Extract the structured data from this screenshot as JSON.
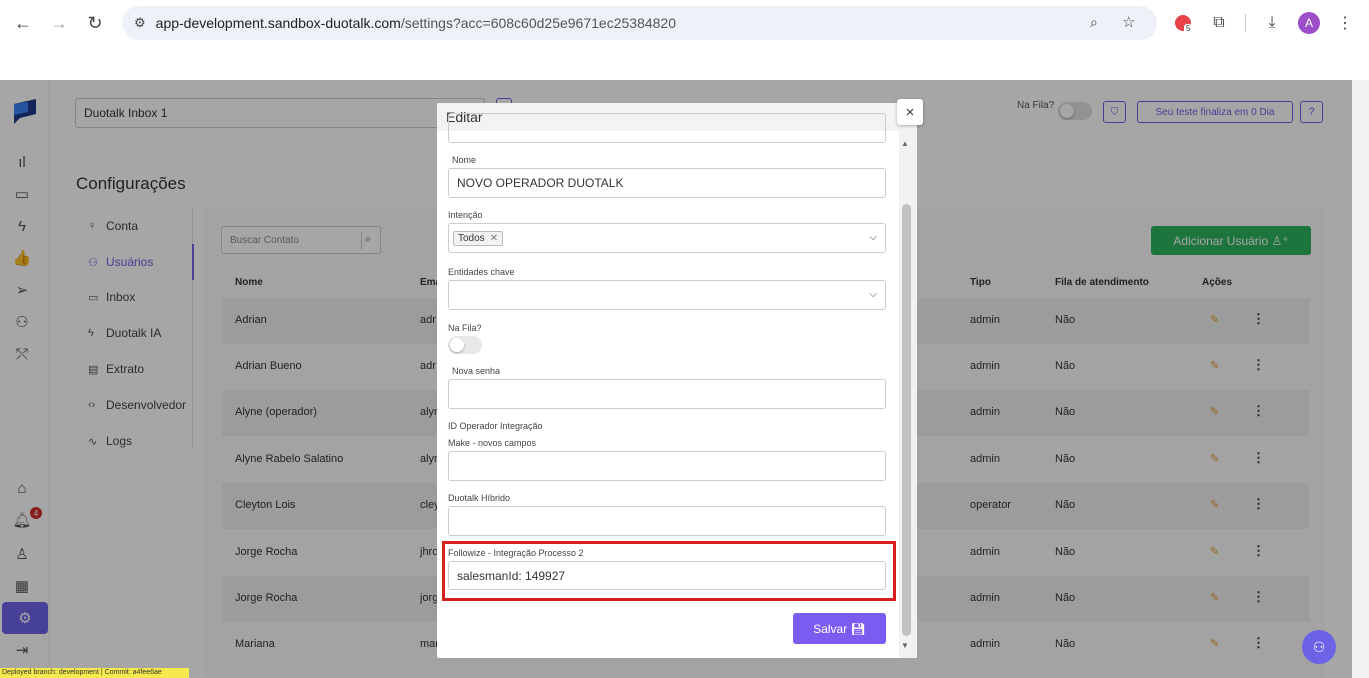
{
  "browser": {
    "url_host": "app-development.sandbox-duotalk.com",
    "url_path": "/settings?acc=608c60d25e9671ec25384820",
    "profile_initial": "A",
    "ext_badge": "5"
  },
  "header": {
    "inbox_select": "Duotalk Inbox 1",
    "queue_label": "Na Fila?",
    "trial_label": "Seu teste finaliza em 0 Dia",
    "help_label": "?"
  },
  "rail": {
    "notification_count": "4"
  },
  "page": {
    "title": "Configurações"
  },
  "settings_menu": [
    {
      "label": "Conta",
      "icon": "medal-icon"
    },
    {
      "label": "Usuários",
      "icon": "users-icon"
    },
    {
      "label": "Inbox",
      "icon": "inbox-icon"
    },
    {
      "label": "Duotalk IA",
      "icon": "bolt-icon"
    },
    {
      "label": "Extrato",
      "icon": "document-icon"
    },
    {
      "label": "Desenvolvedor",
      "icon": "code-icon"
    },
    {
      "label": "Logs",
      "icon": "activity-icon"
    }
  ],
  "users": {
    "search_placeholder": "Buscar Contato",
    "add_button": "Adicionar Usuário",
    "columns": [
      "Nome",
      "Email",
      "Tipo",
      "Fila de atendimento",
      "Ações"
    ],
    "rows": [
      {
        "name": "Adrian",
        "email": "adr",
        "type": "admin",
        "queue": "Não"
      },
      {
        "name": "Adrian Bueno",
        "email": "adr",
        "type": "admin",
        "queue": "Não"
      },
      {
        "name": "Alyne (operador)",
        "email": "alyr",
        "type": "admin",
        "queue": "Não"
      },
      {
        "name": "Alyne Rabelo Salatino",
        "email": "alyr",
        "type": "admin",
        "queue": "Não"
      },
      {
        "name": "Cleyton Lois",
        "email": "cley",
        "type": "operator",
        "queue": "Não"
      },
      {
        "name": "Jorge Rocha",
        "email": "jhro",
        "type": "admin",
        "queue": "Não"
      },
      {
        "name": "Jorge Rocha",
        "email": "jorg",
        "type": "admin",
        "queue": "Não"
      },
      {
        "name": "Mariana",
        "email": "mar",
        "type": "admin",
        "queue": "Não"
      }
    ]
  },
  "modal": {
    "title": "Editar",
    "close": "×",
    "name_label": "Nome",
    "name_value": "NOVO OPERADOR DUOTALK",
    "intent_label": "Intenção",
    "intent_chip": "Todos",
    "entities_label": "Entidades chave",
    "queue_label": "Na Fila?",
    "password_label": "Nova senha",
    "integration_id_label": "ID Operador Integração",
    "make_label": "Make - novos campos",
    "hybrid_label": "Duotalk Híbrido",
    "followize_label": "Followize - Integração Processo 2",
    "followize_value": "salesmanId: 149927",
    "save_button": "Salvar"
  },
  "footer": {
    "deploy_info": "Deployed branch: development | Commit: a4fee6ae"
  },
  "colors": {
    "accent": "#6c63e6",
    "add_button": "#2db35d",
    "highlight": "#d91e1e",
    "save": "#7b5cf0"
  }
}
